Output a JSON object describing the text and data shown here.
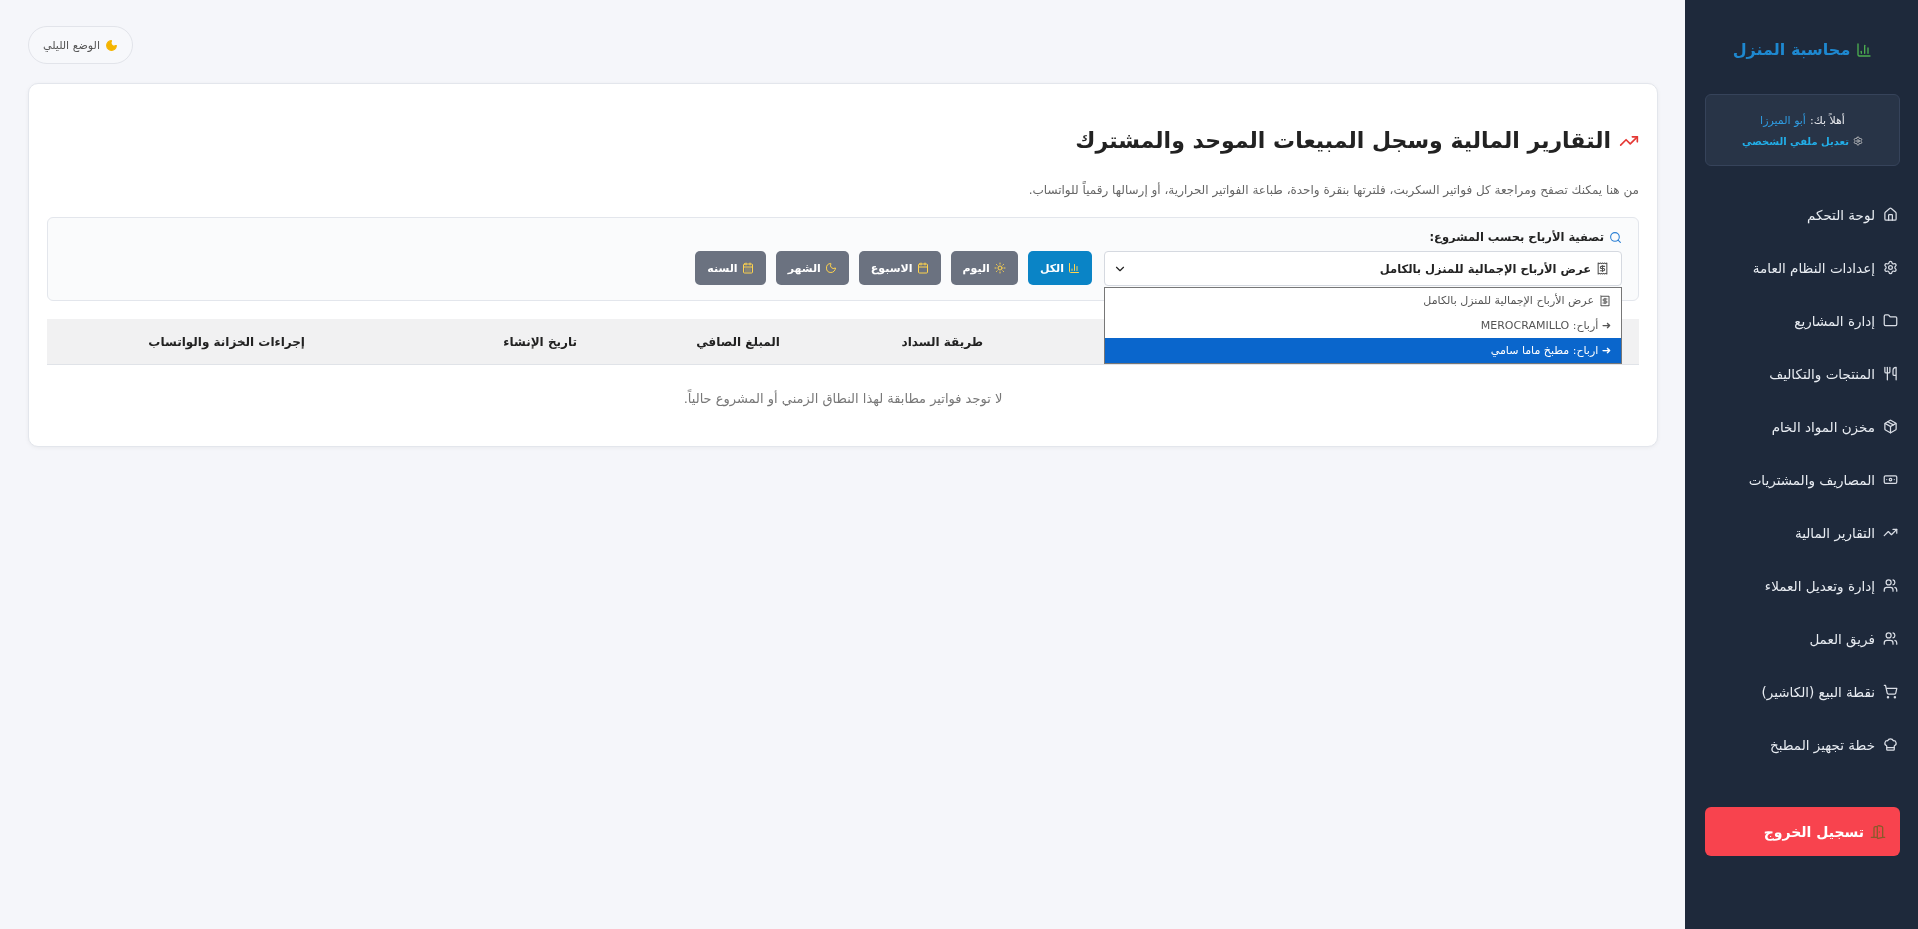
{
  "theme_toggle": {
    "label": "الوضع الليلي"
  },
  "page": {
    "title": "التقارير المالية وسجل المبيعات الموحد والمشترك",
    "description": "من هنا يمكنك تصفح ومراجعة كل فواتير السكربت، فلترتها بنقرة واحدة، طباعة الفواتير الحرارية، أو إرسالها رقمياً للواتساب."
  },
  "filter": {
    "label": "تصفية الأرباح بحسب المشروع:",
    "select": {
      "value": "عرض الأرباح الإجمالية للمنزل بالكامل",
      "expanded": true,
      "options": [
        {
          "label": "عرض الأرباح الإجمالية للمنزل بالكامل",
          "kind": "all",
          "highlighted": false
        },
        {
          "label": "➜ أرباح: MEROCRAMILLO",
          "kind": "project",
          "highlighted": false
        },
        {
          "label": "➜ ارباح: مطبخ ماما سامي",
          "kind": "project",
          "highlighted": true
        }
      ]
    }
  },
  "periods": [
    {
      "label": "الكل",
      "selected": true
    },
    {
      "label": "اليوم",
      "selected": false
    },
    {
      "label": "الاسبوع",
      "selected": false
    },
    {
      "label": "الشهر",
      "selected": false
    },
    {
      "label": "السنه",
      "selected": false
    }
  ],
  "table": {
    "columns": [
      "طريقة السداد",
      "المبلغ الصافي",
      "تاريخ الإنشاء",
      "إجراءات الخزانة والواتساب"
    ],
    "empty_message": "لا توجد فواتير مطابقة لهذا النطاق الزمني أو المشروع حالياً."
  },
  "sidebar": {
    "brand": "محاسبة المنزل",
    "greeting": "أهلاً بك:",
    "user_name": "أبو الميرزا",
    "profile_link": "تعديل ملفي الشخصي",
    "items": [
      {
        "label": "لوحة التحكم"
      },
      {
        "label": "إعدادات النظام العامة"
      },
      {
        "label": "إدارة المشاريع"
      },
      {
        "label": "المنتجات والتكاليف"
      },
      {
        "label": "مخزن المواد الخام"
      },
      {
        "label": "المصاريف والمشتريات"
      },
      {
        "label": "التقارير المالية"
      },
      {
        "label": "إدارة وتعديل العملاء"
      },
      {
        "label": "فريق العمل"
      },
      {
        "label": "نقطة البيع (الكاشير)"
      },
      {
        "label": "خطة تجهيز المطبخ"
      }
    ],
    "logout": "تسجيل الخروج"
  }
}
